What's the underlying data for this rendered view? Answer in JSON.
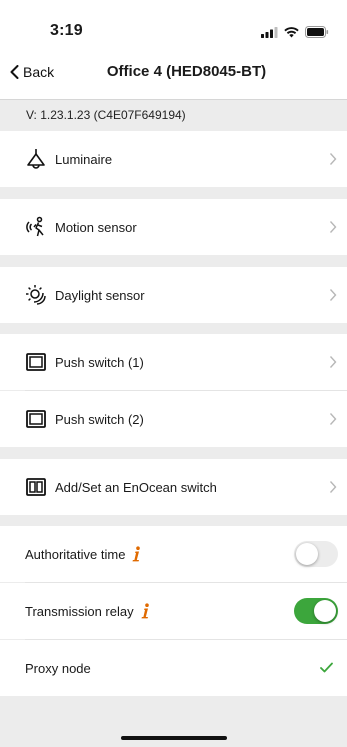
{
  "status": {
    "time": "3:19"
  },
  "nav": {
    "back_label": "Back",
    "title": "Office 4 (HED8045-BT)"
  },
  "version": "V: 1.23.1.23  (C4E07F649194)",
  "menu": [
    {
      "label": "Luminaire",
      "icon": "ceiling-lamp-icon"
    },
    {
      "label": "Motion sensor",
      "icon": "motion-sensor-icon"
    },
    {
      "label": "Daylight sensor",
      "icon": "daylight-sensor-icon"
    },
    {
      "label": "Push switch (1)",
      "icon": "push-switch-icon"
    },
    {
      "label": "Push switch (2)",
      "icon": "push-switch-icon"
    },
    {
      "label": "Add/Set an EnOcean switch",
      "icon": "enocean-switch-icon"
    }
  ],
  "settings": {
    "authoritative_time": {
      "label": "Authoritative time",
      "on": false
    },
    "transmission_relay": {
      "label": "Transmission relay",
      "on": true
    },
    "proxy_node": {
      "label": "Proxy node",
      "checked": true
    }
  },
  "colors": {
    "toggle_on": "#3ca63c",
    "toggle_off": "#ececec",
    "info": "#e06a00",
    "check": "#3ca63c"
  }
}
